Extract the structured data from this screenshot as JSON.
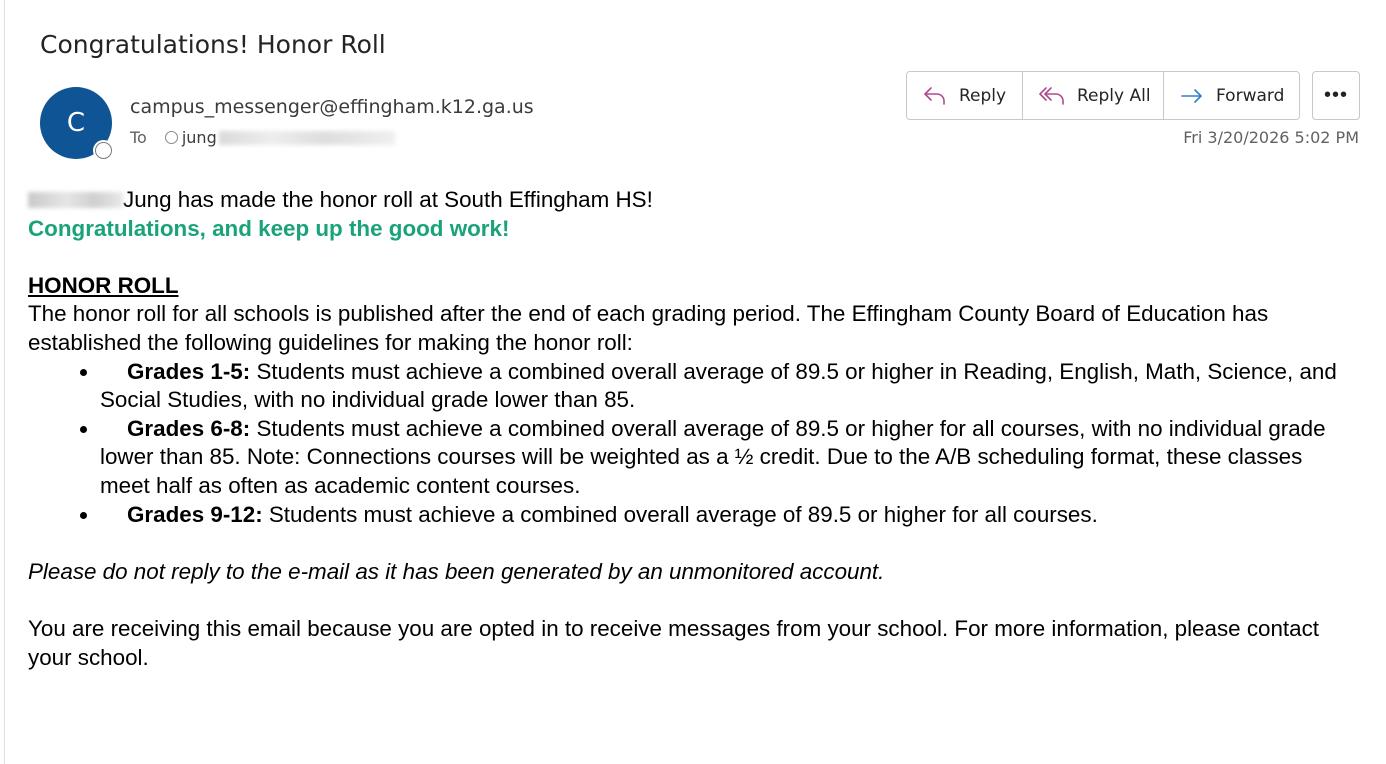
{
  "email": {
    "subject": "Congratulations! Honor Roll",
    "avatar_initial": "C",
    "sender": "campus_messenger@effingham.k12.ga.us",
    "to_label": "To",
    "recipient_visible": "jung",
    "date": "Fri 3/20/2026 5:02 PM"
  },
  "toolbar": {
    "reply_label": "Reply",
    "reply_all_label": "Reply All",
    "forward_label": "Forward",
    "more_label": "•••"
  },
  "colors": {
    "accent_green": "#1aa37a",
    "avatar_blue": "#0f5494",
    "reply_icon": "#b04b8b",
    "forward_icon": "#2f7fd1"
  },
  "message": {
    "intro_suffix": "Jung has made the honor roll at South Effingham HS!",
    "congrats": "Congratulations, and keep up the good work!",
    "heading": "HONOR ROLL",
    "paragraph": "The honor roll for all schools is published after the end of each grading period. The Effingham County Board of Education has established the following guidelines for making the honor roll:",
    "grades": [
      {
        "label": "Grades 1-5:",
        "text": " Students must achieve a combined overall average of 89.5 or higher in Reading, English, Math, Science, and Social Studies, with no individual grade lower than 85."
      },
      {
        "label": "Grades 6-8:",
        "text": " Students must achieve a combined overall average of 89.5 or higher for all courses, with no individual grade lower than 85. Note: Connections courses will be weighted as a ½ credit. Due to the A/B scheduling format, these classes meet half as often as academic content courses."
      },
      {
        "label": "Grades 9-12:",
        "text": " Students must achieve a combined overall average of 89.5 or higher for all courses."
      }
    ],
    "no_reply": "Please do not reply to the e-mail as it has been generated by an unmonitored account.",
    "footer": "You are receiving this email because you are opted in to receive messages from your school. For more information, please contact your school."
  }
}
